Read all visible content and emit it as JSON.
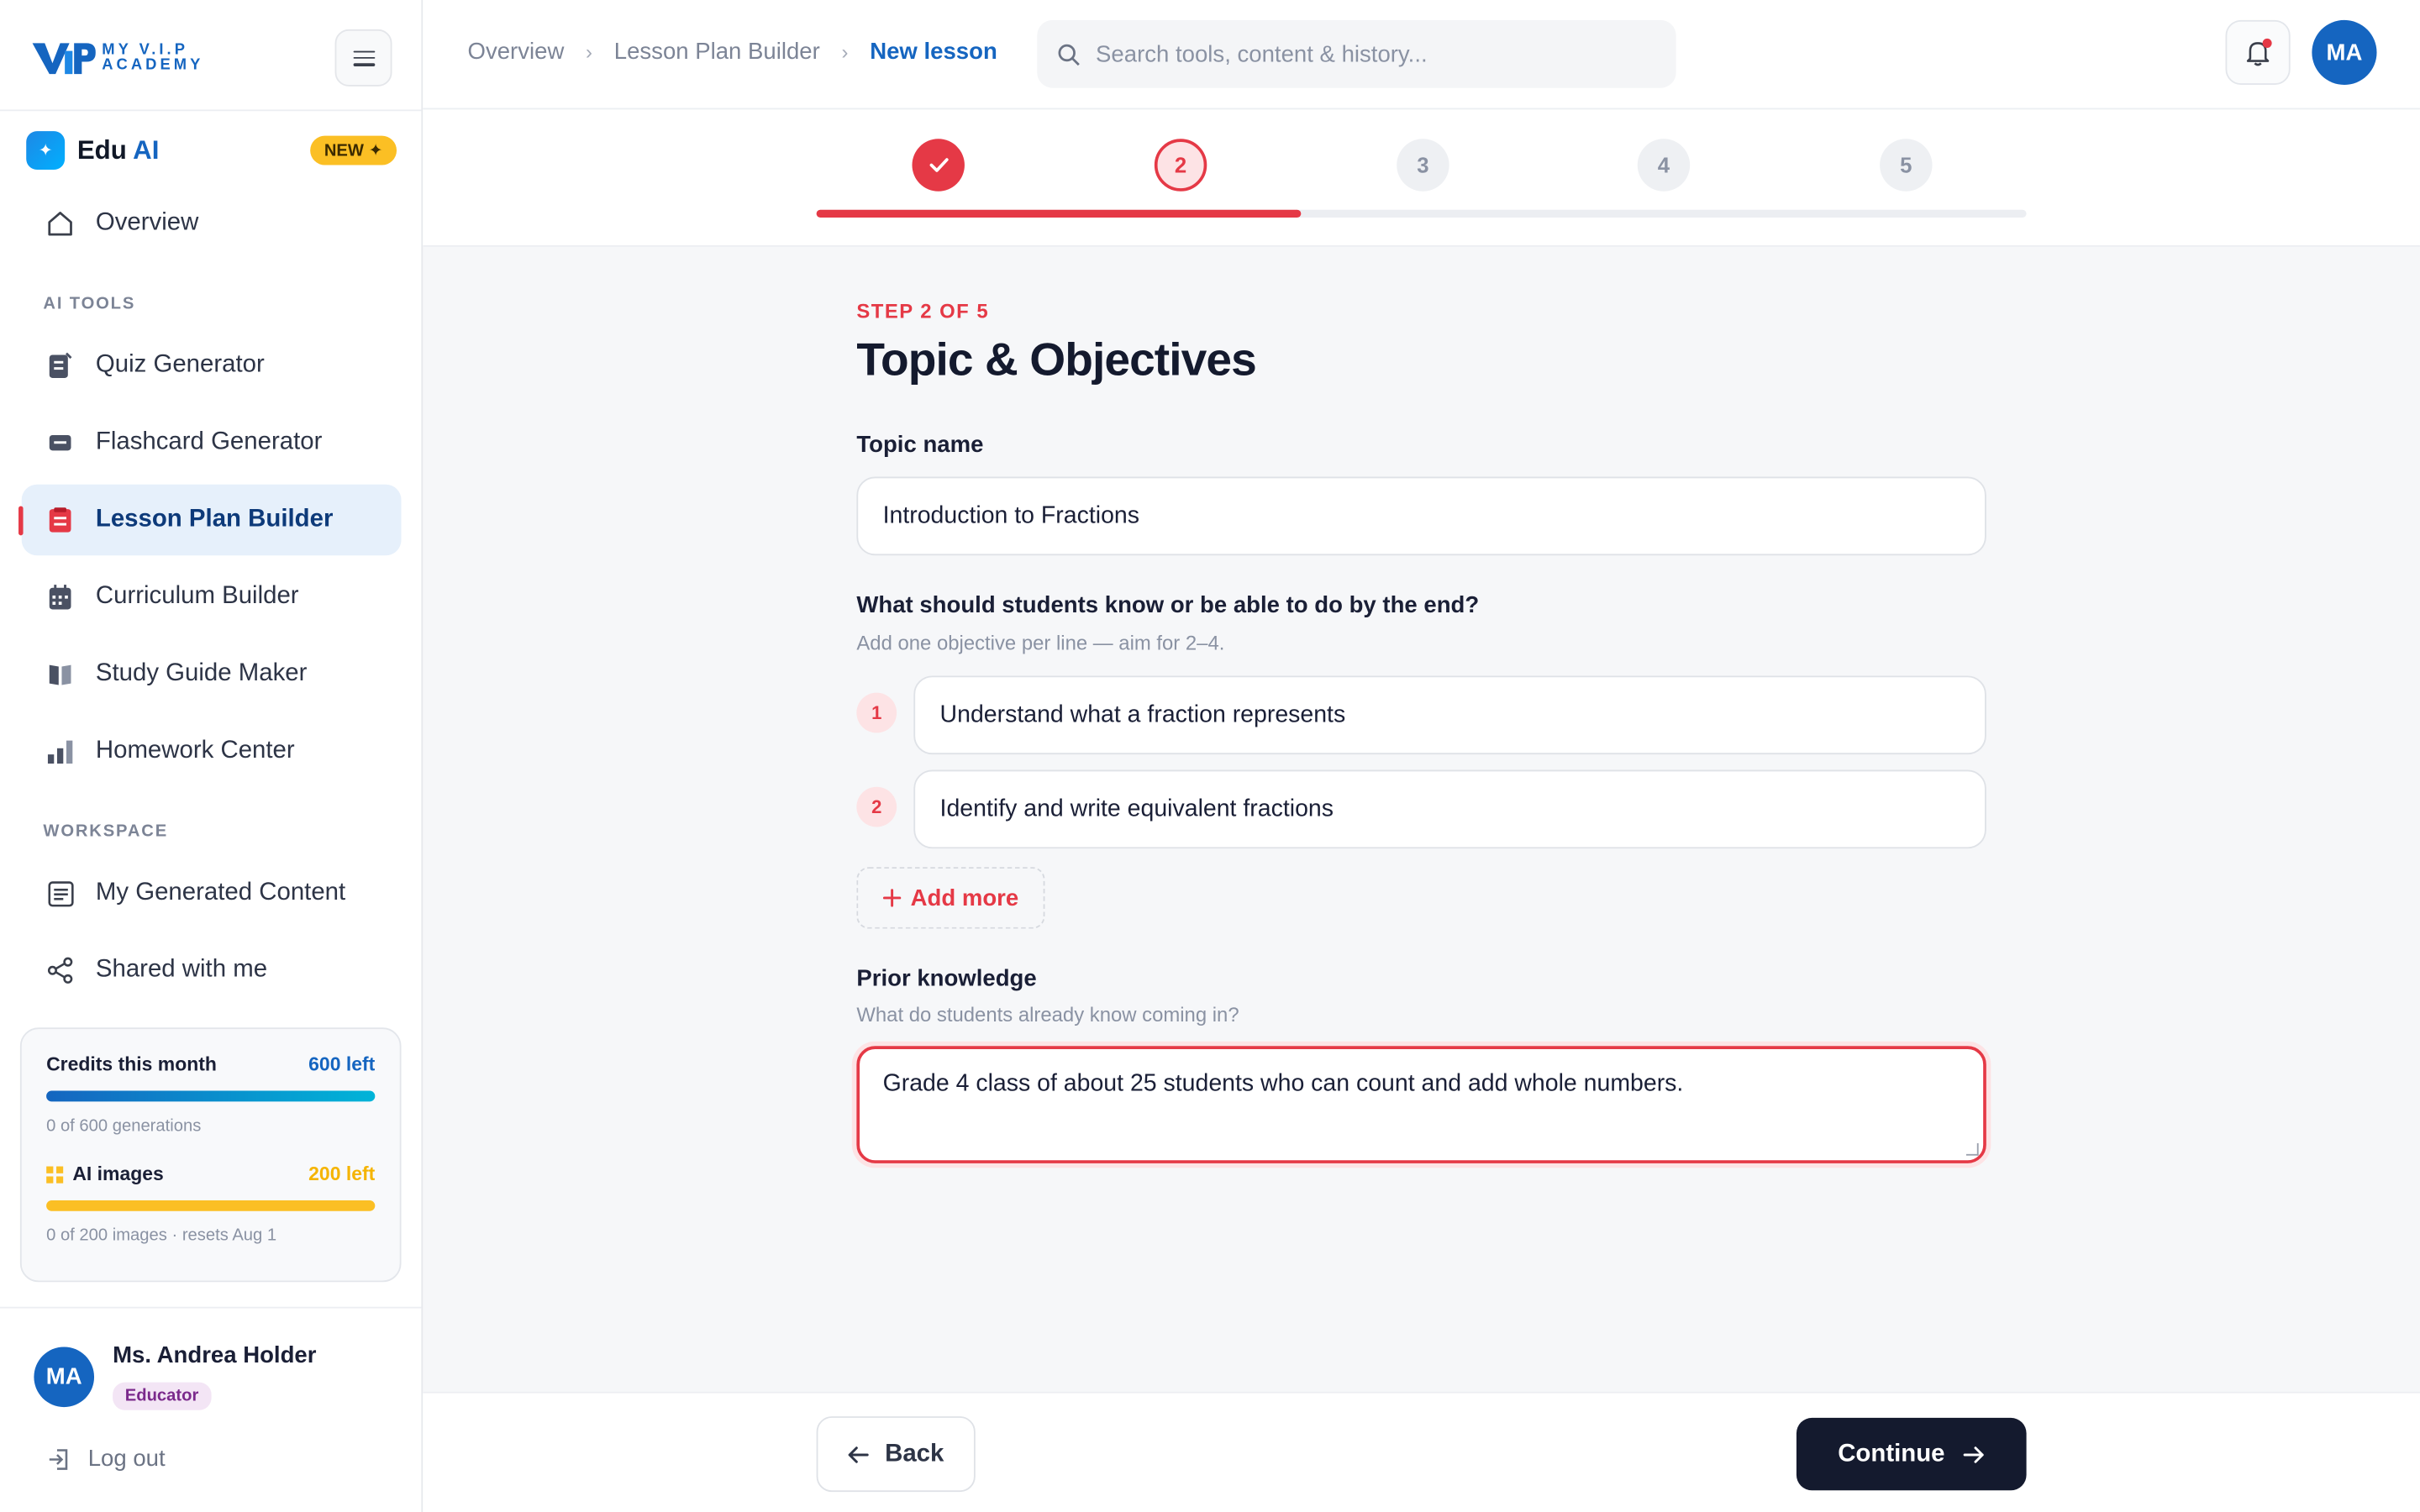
{
  "brand": {
    "logo_text_line1": "MY V.I.P",
    "logo_text_line2": "ACADEMY"
  },
  "eduai": {
    "label": "Edu",
    "label_accent": "AI",
    "badge": "NEW ✦"
  },
  "sidebar": {
    "overview": "Overview",
    "ai_tools_label": "AI TOOLS",
    "ai_tools": [
      {
        "label": "Quiz Generator",
        "icon": "quiz-icon"
      },
      {
        "label": "Flashcard Generator",
        "icon": "flashcard-icon"
      },
      {
        "label": "Lesson Plan Builder",
        "icon": "lesson-plan-icon"
      },
      {
        "label": "Curriculum Builder",
        "icon": "calendar-icon"
      },
      {
        "label": "Study Guide Maker",
        "icon": "book-icon"
      },
      {
        "label": "Homework Center",
        "icon": "chart-icon"
      }
    ],
    "workspace_label": "WORKSPACE",
    "workspace": [
      {
        "label": "My Generated Content",
        "icon": "document-icon"
      },
      {
        "label": "Shared with me",
        "icon": "share-icon"
      }
    ]
  },
  "credits": {
    "title": "Credits this month",
    "left": "600 left",
    "progress": 1.0,
    "sub": "0 of 600 generations",
    "images_title": "AI images",
    "images_left": "200 left",
    "images_progress": 1.0,
    "images_sub": "0 of 200 images · resets Aug 1"
  },
  "user": {
    "initials": "MA",
    "name": "Ms. Andrea Holder",
    "role": "Educator",
    "logout": "Log out"
  },
  "header": {
    "breadcrumbs": [
      "Overview",
      "Lesson Plan Builder",
      "New lesson"
    ],
    "search_placeholder": "Search tools, content & history...",
    "avatar": "MA"
  },
  "stepper": {
    "steps": [
      "2",
      "3",
      "4",
      "5"
    ],
    "progress": 0.4
  },
  "form": {
    "step_label": "STEP 2 OF 5",
    "title": "Topic & Objectives",
    "topic_label": "Topic name",
    "topic_value": "Introduction to Fractions",
    "objectives_label": "What should students know or be able to do by the end?",
    "objectives_hint": "Add one objective per line — aim for 2–4.",
    "objectives": [
      {
        "num": "1",
        "text": "Understand what a fraction represents"
      },
      {
        "num": "2",
        "text": "Identify and write equivalent fractions"
      }
    ],
    "add_more": "Add more",
    "prior_label": "Prior knowledge",
    "prior_hint": "What do students already know coming in?",
    "prior_value": "Grade 4 class of about 25 students who can count and add whole numbers."
  },
  "footer": {
    "back": "Back",
    "continue": "Continue"
  },
  "colors": {
    "accent": "#e53946",
    "brand": "#1565c0",
    "dark": "#141a2e",
    "credits_bar": "#1e88e5",
    "images_bar": "#fbbf24"
  }
}
